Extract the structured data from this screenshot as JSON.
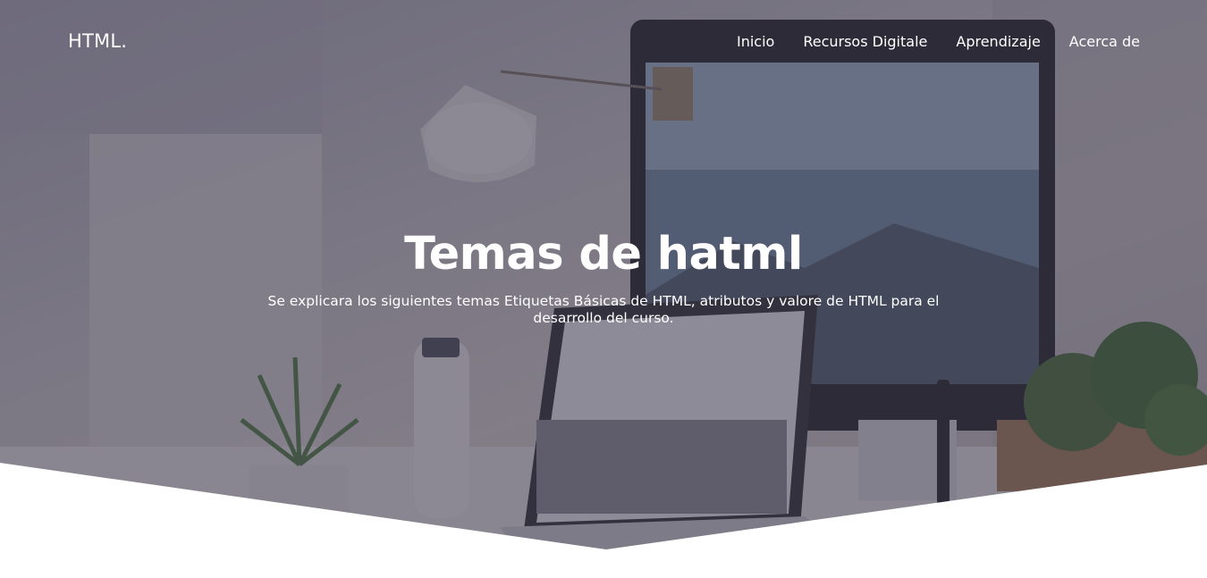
{
  "brand": "HTML.",
  "nav": {
    "items": [
      {
        "label": "Inicio"
      },
      {
        "label": "Recursos Digitale"
      },
      {
        "label": "Aprendizaje"
      },
      {
        "label": "Acerca de"
      }
    ]
  },
  "hero": {
    "title": "Temas de hatml",
    "subtitle": "Se explicara los siguientes temas Etiquetas Básicas de HTML, atributos y valore de HTML para el desarrollo del curso."
  },
  "colors": {
    "overlay": "#3a374a",
    "text": "#ffffff",
    "background": "#ffffff"
  }
}
